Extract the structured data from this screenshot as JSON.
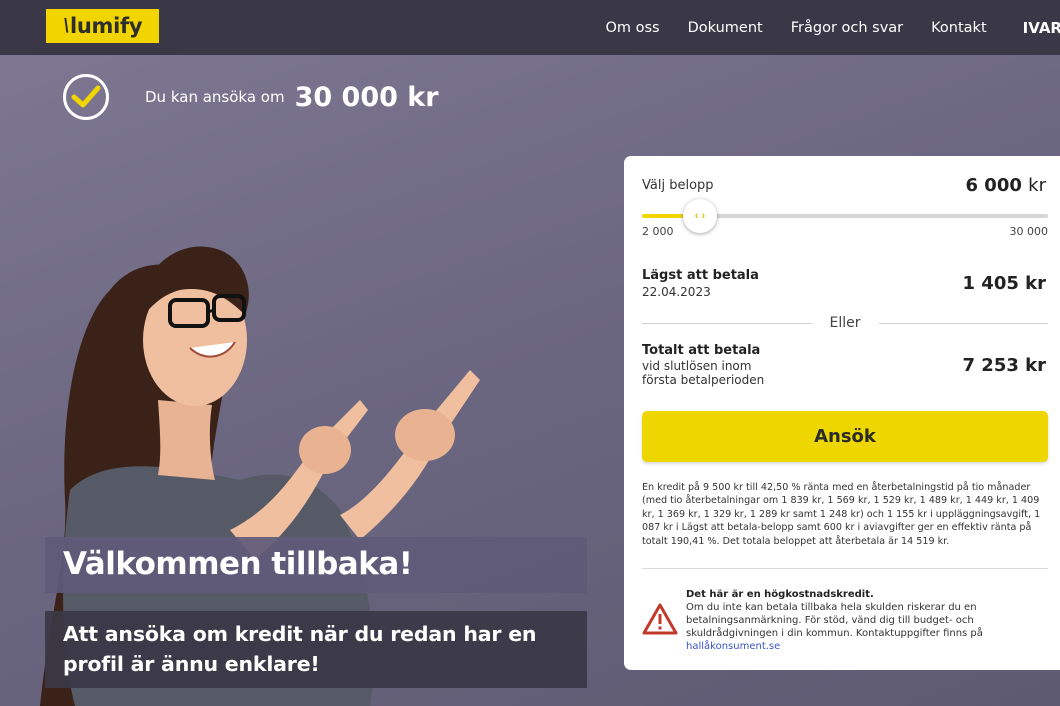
{
  "brand": {
    "logo_text": "lumify",
    "logo_mark": "\\"
  },
  "nav": {
    "items": [
      "Om oss",
      "Dokument",
      "Frågor och svar",
      "Kontakt"
    ],
    "user": "IVAR"
  },
  "eligibility": {
    "text": "Du kan ansöka om",
    "amount": "30 000 kr"
  },
  "hero": {
    "title": "Välkommen tillbaka!",
    "subtitle": "Att ansöka om kredit när du redan har en profil är ännu enklare!"
  },
  "calculator": {
    "amount_label": "Välj belopp",
    "amount_value": "6 000",
    "amount_unit": "kr",
    "slider_min_label": "2 000",
    "slider_max_label": "30 000",
    "slider_fraction": 0.143,
    "lowest_label": "Lägst att betala",
    "lowest_date": "22.04.2023",
    "lowest_value": "1 405 kr",
    "or_label": "Eller",
    "total_label": "Totalt att betala",
    "total_sub1": "vid slutlösen inom",
    "total_sub2": "första betalperioden",
    "total_value": "7 253 kr",
    "apply_label": "Ansök",
    "disclaimer": "En kredit på 9 500 kr till 42,50 % ränta med en återbetalningstid på tio månader (med tio återbetalningar om 1 839 kr, 1 569 kr, 1 529 kr, 1 489 kr, 1 449 kr, 1 409 kr, 1 369 kr, 1 329 kr, 1 289 kr samt 1 248 kr) och 1 155 kr i uppläggningsavgift, 1 087 kr i Lägst att betala-belopp samt 600 kr i aviavgifter ger en effektiv ränta på totalt 190,41 %. Det totala beloppet att återbetala är 14 519 kr.",
    "warning_title": "Det här är en högkostnadskredit.",
    "warning_text": "Om du inte kan betala tillbaka hela skulden riskerar du en betalningsanmärkning. För stöd, vänd dig till budget- och skuldrådgivningen i din kommun. Kontaktuppgifter finns på",
    "warning_link": "hallåkonsument.se"
  },
  "colors": {
    "accent": "#f1d400",
    "header": "#3a3847",
    "warning": "#c0392b"
  }
}
